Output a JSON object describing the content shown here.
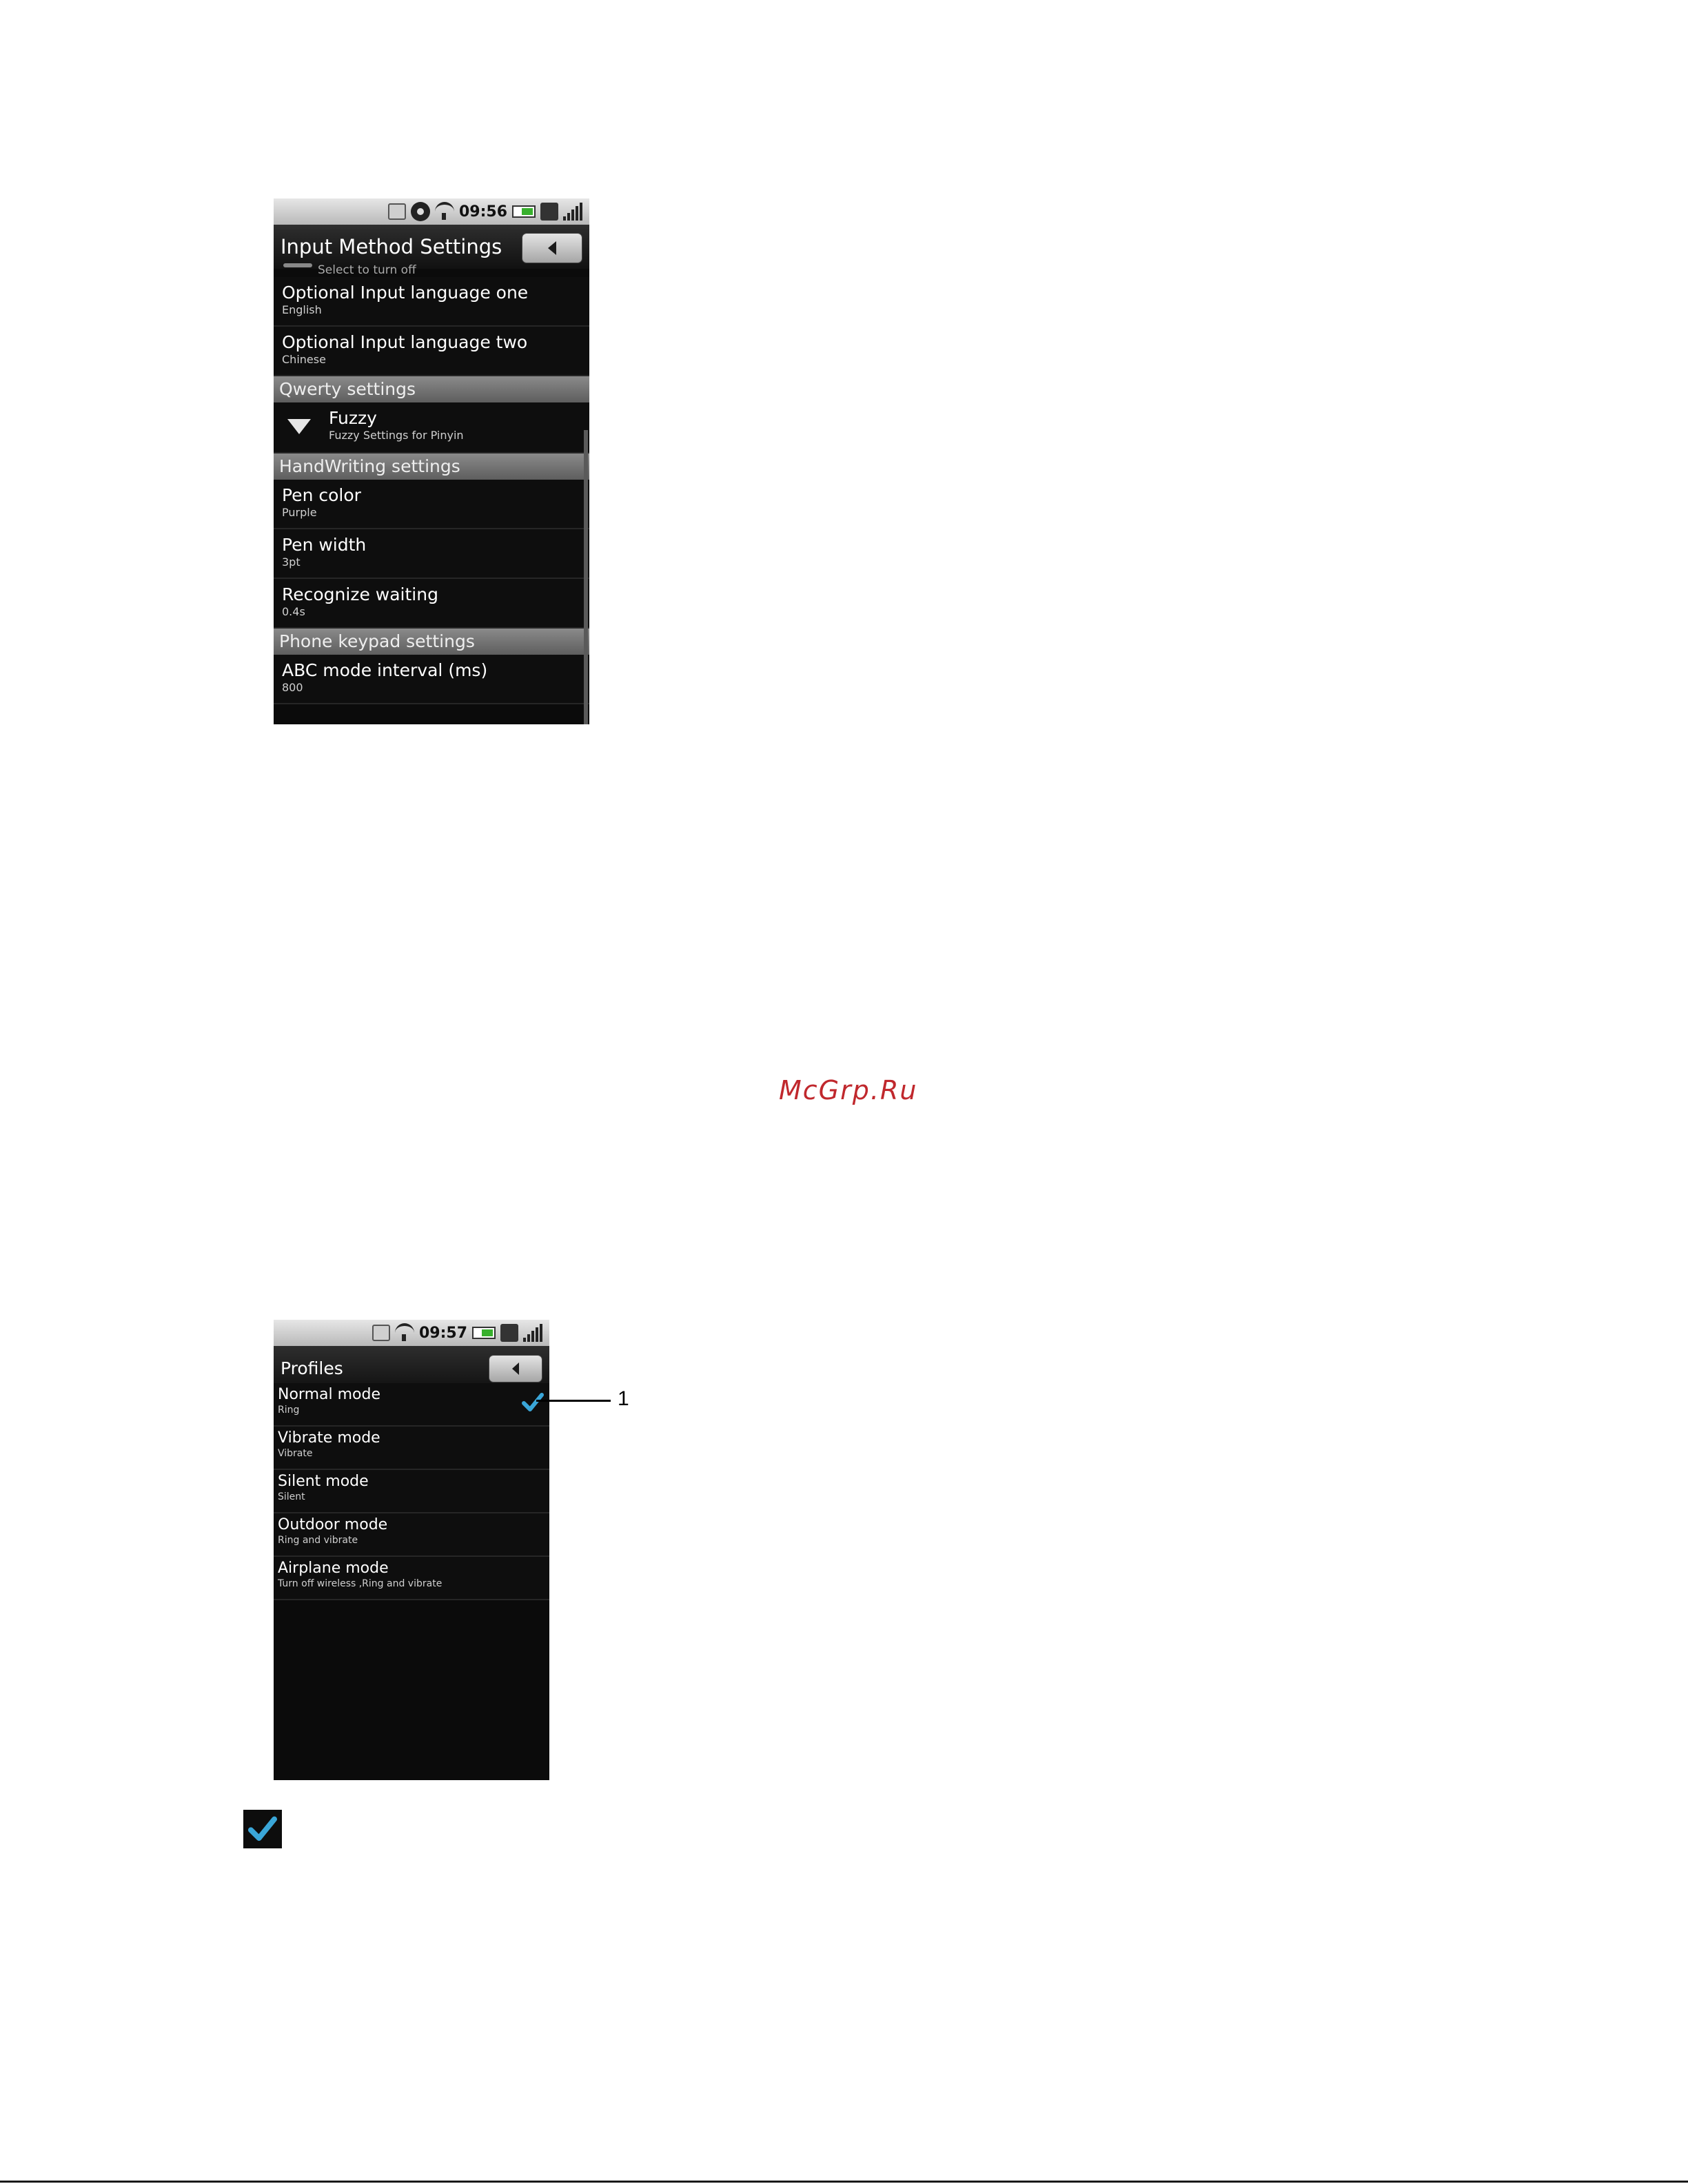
{
  "watermark": "McGrp.Ru",
  "callout": "1",
  "screen1": {
    "status_time": "09:56",
    "title": "Input Method Settings",
    "partial_item": "Select to turn off",
    "items_a": [
      {
        "title": "Optional Input language one",
        "subtitle": "English"
      },
      {
        "title": "Optional Input language two",
        "subtitle": "Chinese"
      }
    ],
    "section_qwerty": "Qwerty settings",
    "fuzzy": {
      "title": "Fuzzy",
      "subtitle": "Fuzzy Settings for Pinyin"
    },
    "section_handwriting": "HandWriting settings",
    "items_b": [
      {
        "title": "Pen color",
        "subtitle": "Purple"
      },
      {
        "title": "Pen width",
        "subtitle": "3pt"
      },
      {
        "title": "Recognize waiting",
        "subtitle": "0.4s"
      }
    ],
    "section_keypad": "Phone keypad settings",
    "items_c": [
      {
        "title": "ABC mode interval (ms)",
        "subtitle": "800"
      }
    ]
  },
  "screen2": {
    "status_time": "09:57",
    "title": "Profiles",
    "items": [
      {
        "title": "Normal mode",
        "subtitle": "Ring"
      },
      {
        "title": "Vibrate mode",
        "subtitle": "Vibrate"
      },
      {
        "title": "Silent mode",
        "subtitle": "Silent"
      },
      {
        "title": "Outdoor mode",
        "subtitle": "Ring and vibrate"
      },
      {
        "title": "Airplane mode",
        "subtitle": "Turn off wireless ,Ring and vibrate"
      }
    ]
  },
  "icons": {
    "check": "check-icon",
    "back": "back-arrow-icon",
    "expand": "chevron-down-icon"
  },
  "colors": {
    "check_accent": "#3aa6d8",
    "section_bg": "#6f6f6f",
    "watermark": "#c0282d"
  }
}
